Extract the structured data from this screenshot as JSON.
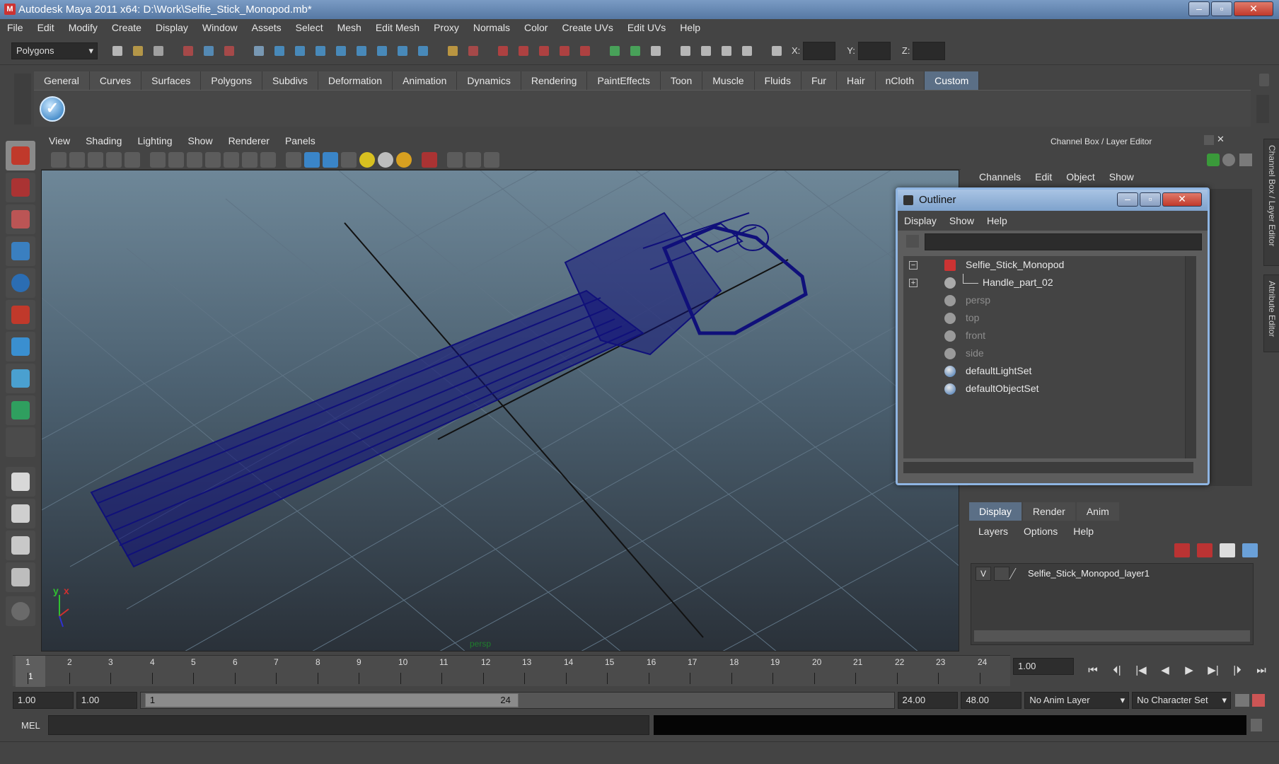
{
  "window": {
    "title": "Autodesk Maya 2011 x64: D:\\Work\\Selfie_Stick_Monopod.mb*",
    "app_icon": "M",
    "minimize": "–",
    "maximize": "▫",
    "close": "✕"
  },
  "menus": [
    "File",
    "Edit",
    "Modify",
    "Create",
    "Display",
    "Window",
    "Assets",
    "Select",
    "Mesh",
    "Edit Mesh",
    "Proxy",
    "Normals",
    "Color",
    "Create UVs",
    "Edit UVs",
    "Help"
  ],
  "status_line": {
    "menu_set": "Polygons",
    "x_label": "X:",
    "y_label": "Y:",
    "z_label": "Z:"
  },
  "shelf": {
    "tabs": [
      "General",
      "Curves",
      "Surfaces",
      "Polygons",
      "Subdivs",
      "Deformation",
      "Animation",
      "Dynamics",
      "Rendering",
      "PaintEffects",
      "Toon",
      "Muscle",
      "Fluids",
      "Fur",
      "Hair",
      "nCloth",
      "Custom"
    ],
    "active_tab": "Custom",
    "icon_glyph": "✓"
  },
  "viewport": {
    "menu": [
      "View",
      "Shading",
      "Lighting",
      "Show",
      "Renderer",
      "Panels"
    ],
    "camera_label": "persp",
    "axis_y": "y",
    "axis_x": "x"
  },
  "channel_box": {
    "header": "Channel Box / Layer Editor",
    "menu": [
      "Channels",
      "Edit",
      "Object",
      "Show"
    ],
    "side_tabs": [
      "Channel Box / Layer Editor",
      "Attribute Editor"
    ]
  },
  "outliner": {
    "title": "Outliner",
    "menu": [
      "Display",
      "Show",
      "Help"
    ],
    "items": [
      {
        "label": "Selfie_Stick_Monopod",
        "expander": "−",
        "icon": "group-icon",
        "dim": false,
        "indent": 0
      },
      {
        "label": "Handle_part_02",
        "expander": "+",
        "icon": "mesh-icon",
        "dim": false,
        "indent": 1
      },
      {
        "label": "persp",
        "expander": "",
        "icon": "camera-icon",
        "dim": true,
        "indent": 0
      },
      {
        "label": "top",
        "expander": "",
        "icon": "camera-icon",
        "dim": true,
        "indent": 0
      },
      {
        "label": "front",
        "expander": "",
        "icon": "camera-icon",
        "dim": true,
        "indent": 0
      },
      {
        "label": "side",
        "expander": "",
        "icon": "camera-icon",
        "dim": true,
        "indent": 0
      },
      {
        "label": "defaultLightSet",
        "expander": "",
        "icon": "set-icon",
        "dim": false,
        "indent": 0
      },
      {
        "label": "defaultObjectSet",
        "expander": "",
        "icon": "set-icon",
        "dim": false,
        "indent": 0
      }
    ]
  },
  "layer_editor": {
    "tabs": [
      "Display",
      "Render",
      "Anim"
    ],
    "active_tab": "Display",
    "menu": [
      "Layers",
      "Options",
      "Help"
    ],
    "layers": [
      {
        "visible": "V",
        "name": "Selfie_Stick_Monopod_layer1"
      }
    ]
  },
  "time_slider": {
    "frames": [
      "1",
      "2",
      "3",
      "4",
      "5",
      "6",
      "7",
      "8",
      "9",
      "10",
      "11",
      "12",
      "13",
      "14",
      "15",
      "16",
      "17",
      "18",
      "19",
      "20",
      "21",
      "22",
      "23",
      "24"
    ],
    "current_frame": "1",
    "current_time": "1.00"
  },
  "playback": {
    "buttons": [
      "⏮",
      "⏴|",
      "|◀",
      "◀",
      "▶",
      "▶|",
      "|⏵",
      "⏭"
    ]
  },
  "range": {
    "start": "1.00",
    "playback_start": "1.00",
    "handle_start": "1",
    "handle_end": "24",
    "playback_end": "24.00",
    "end": "48.00",
    "anim_layer": "No Anim Layer",
    "character_set": "No Character Set"
  },
  "command_line": {
    "label": "MEL"
  },
  "colors": {
    "accent_tab": "#5b6f86",
    "wireframe": "#10107a",
    "outliner_border": "#8fb5e2"
  }
}
